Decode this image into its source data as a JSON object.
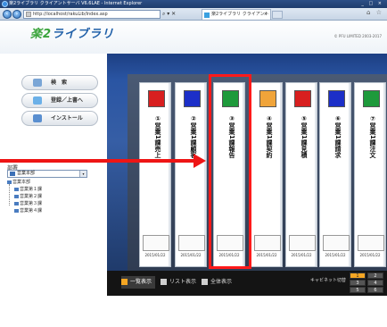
{
  "browser": {
    "title": "楽2ライブラリ クライアントサーバ V6.6LAE - Internet Explorer",
    "window_controls": "_ □ ×",
    "url": "http://localhost/rakuLib/Index.asp",
    "url_controls": "⌕ ▾ ✕",
    "tab_title": "楽2ライブラリ クライアントサー...",
    "tab_close": "×",
    "right_controls": "⌂ ☆"
  },
  "app": {
    "logo_main": "楽2",
    "logo_sub": "ライブラリ",
    "copyright": "© PFU LIMITED 2003-2017"
  },
  "menu": {
    "search": "検　索",
    "register": "登録／上書へ",
    "install": "インストール"
  },
  "tree": {
    "dept_label": "部署",
    "dept_value": "営業本部",
    "dept_arrow": "▾",
    "root": "営業本部",
    "children": [
      "営業第１課",
      "営業第２課",
      "営業第３課",
      "営業第４課"
    ]
  },
  "binders": [
    {
      "title": "①営業1課売上",
      "date": "2015/01/22",
      "color": "#d81f1f"
    },
    {
      "title": "②営業1課顧客",
      "date": "2015/01/22",
      "color": "#1c2fc8"
    },
    {
      "title": "③営業1課報告",
      "date": "2015/01/22",
      "color": "#1e9a3b"
    },
    {
      "title": "④営業1課契約",
      "date": "2015/01/22",
      "color": "#f0a43a"
    },
    {
      "title": "⑤営業1課見積",
      "date": "2015/01/22",
      "color": "#d81f1f"
    },
    {
      "title": "⑥営業1課請求",
      "date": "2015/01/22",
      "color": "#1c2fc8"
    },
    {
      "title": "⑦営業1課注文",
      "date": "2015/01/22",
      "color": "#1e9a3b"
    }
  ],
  "bottombar": {
    "view_icon": "一覧表示",
    "view_list": "リスト表示",
    "view_all": "全体表示",
    "cabinet_switch": "キャビネット切替",
    "pager": [
      "1",
      "2",
      "3",
      "4",
      "5",
      "6"
    ]
  },
  "colors": {
    "highlight": "#ff1a1a",
    "arrow": "#ee1515",
    "active_view": "#f5a623"
  }
}
